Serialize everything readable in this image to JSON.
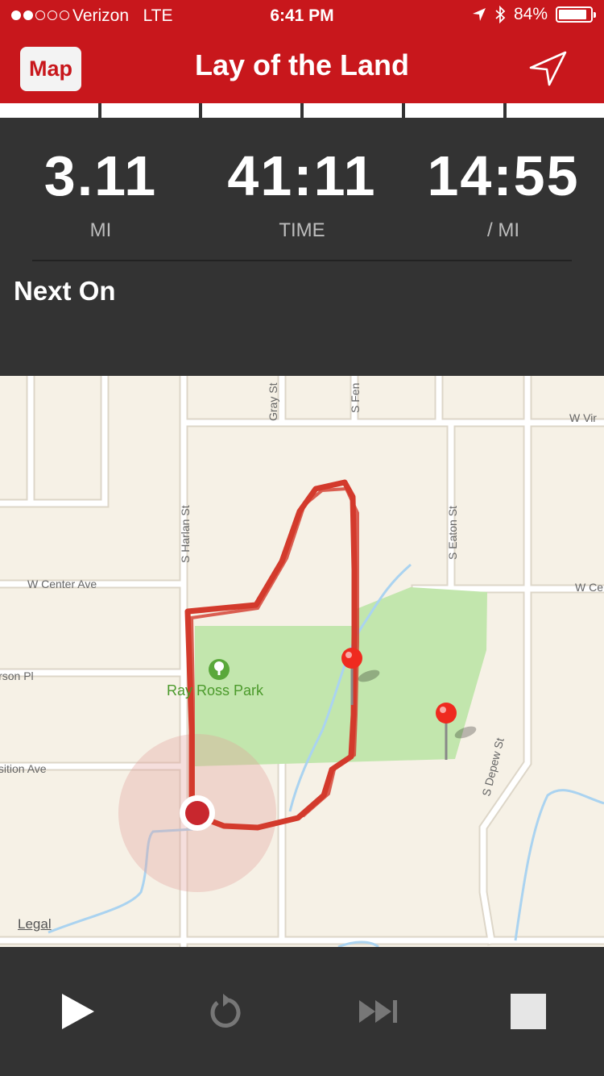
{
  "status_bar": {
    "carrier": "Verizon",
    "network": "LTE",
    "time": "6:41 PM",
    "battery": "84%",
    "battery_level": 0.84,
    "signal_bars": 2,
    "signal_total": 5
  },
  "header": {
    "map_button_label": "Map",
    "title": "Lay of the Land",
    "navigation_icon": "location-arrow-icon"
  },
  "stats": {
    "distance": {
      "value": "3.11",
      "label": "MI"
    },
    "time": {
      "value": "41:11",
      "label": "TIME"
    },
    "pace": {
      "value": "14:55",
      "label": "/ MI"
    }
  },
  "next": {
    "label": "Next On"
  },
  "map": {
    "streets": {
      "harlan": "S Harlan St",
      "center": "W Center Ave",
      "jefferson": "Jefferson Pl",
      "exposition": "Exposition Ave",
      "gray": "Gray St",
      "fenton": "S Fen",
      "eaton": "S Eaton St",
      "depew": "S Depew St",
      "virginia": "W Vir",
      "center_right": "W Ce"
    },
    "park_name": "Ray Ross Park",
    "legal_link": "Legal",
    "route_color": "#d33a2c",
    "park_color": "#c2e6ad",
    "water_color": "#aad3f0"
  },
  "controls": {
    "play": "play-icon",
    "restart": "restart-icon",
    "skip": "skip-forward-icon",
    "stop": "stop-icon"
  },
  "colors": {
    "brand_red": "#c8171c",
    "panel_dark": "#333333",
    "map_bg": "#f6f1e6"
  }
}
